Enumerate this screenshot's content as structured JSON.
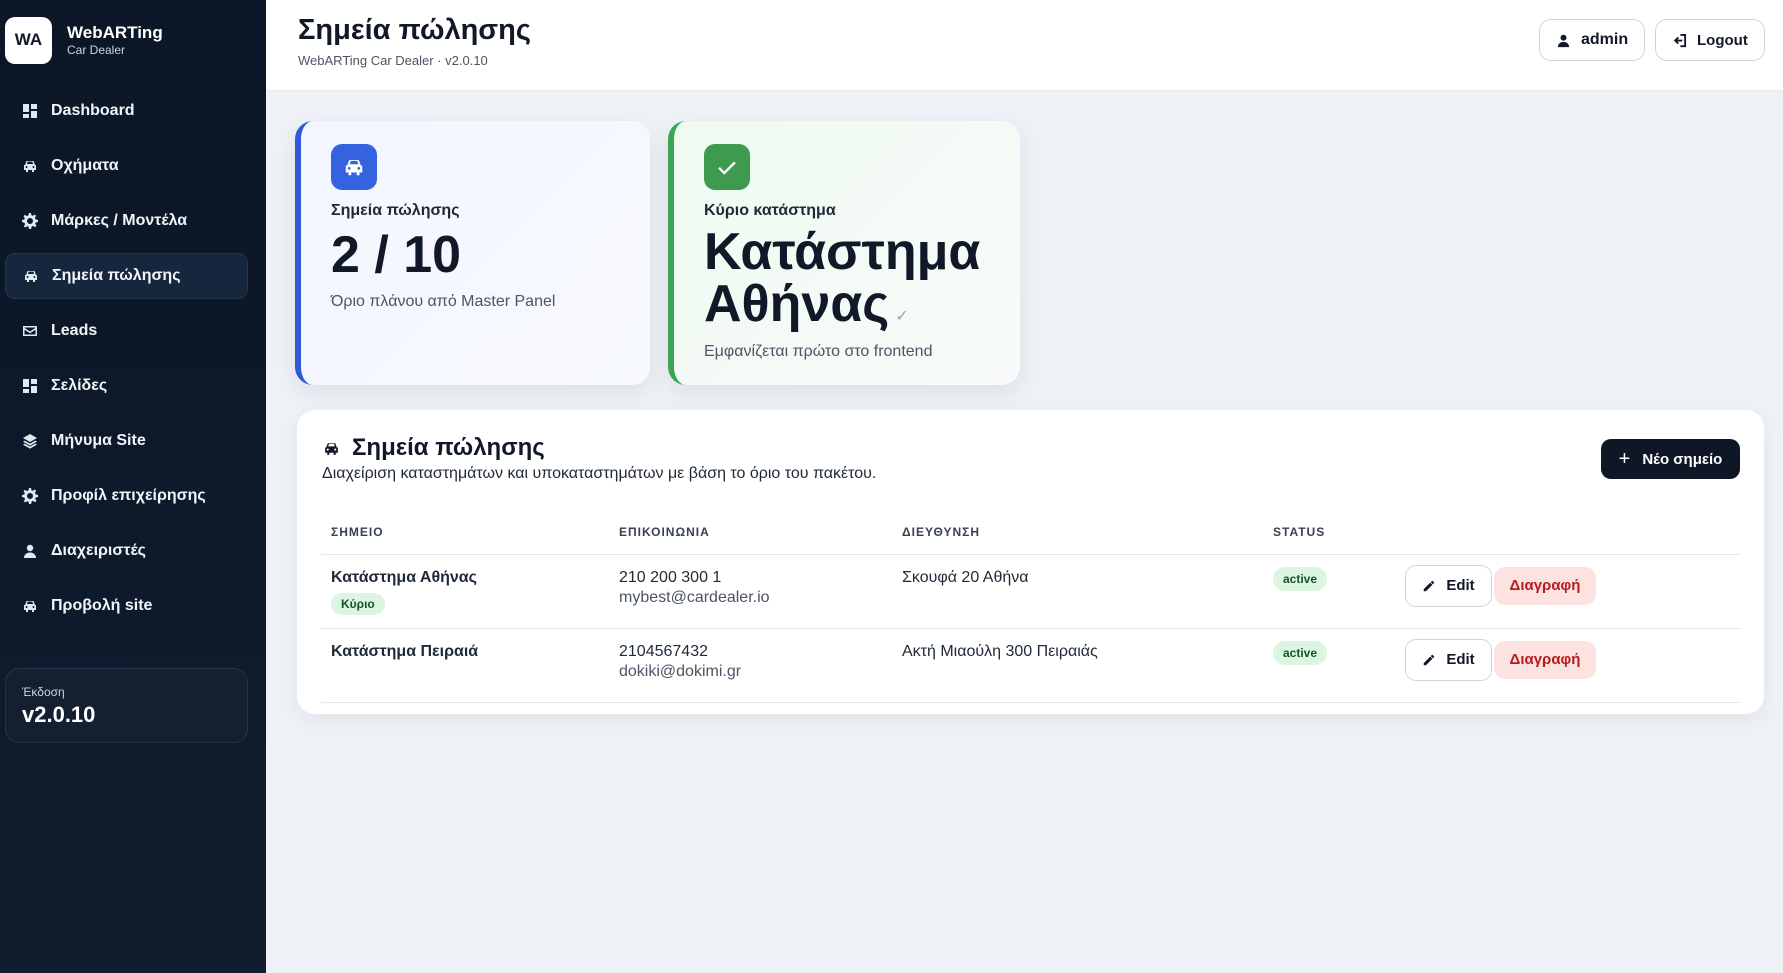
{
  "brand": {
    "logo": "WA",
    "name": "WebARTing",
    "sub": "Car Dealer"
  },
  "sidebar": {
    "items": [
      {
        "label": "Dashboard",
        "icon": "dashboard-icon"
      },
      {
        "label": "Οχήματα",
        "icon": "car-icon"
      },
      {
        "label": "Μάρκες / Μοντέλα",
        "icon": "gear-icon"
      },
      {
        "label": "Σημεία πώλησης",
        "icon": "car-icon",
        "active": true
      },
      {
        "label": "Leads",
        "icon": "mail-icon"
      },
      {
        "label": "Σελίδες",
        "icon": "dashboard-icon"
      },
      {
        "label": "Μήνυμα Site",
        "icon": "layers-icon"
      },
      {
        "label": "Προφίλ επιχείρησης",
        "icon": "gear-icon"
      },
      {
        "label": "Διαχειριστές",
        "icon": "user-icon"
      },
      {
        "label": "Προβολή site",
        "icon": "car-icon"
      }
    ],
    "version_label": "Έκδοση",
    "version_value": "v2.0.10"
  },
  "header": {
    "title": "Σημεία πώλησης",
    "subtitle": "WebARTing Car Dealer · v2.0.10",
    "user_label": "admin",
    "logout_label": "Logout"
  },
  "stats": {
    "points": {
      "label": "Σημεία πώλησης",
      "value": "2 / 10",
      "note": "Όριο πλάνου από Master Panel"
    },
    "main_store": {
      "label": "Κύριο κατάστημα",
      "value": "Κατάστημα Αθήνας",
      "note": "Εμφανίζεται πρώτο στο frontend"
    }
  },
  "panel": {
    "title": "Σημεία πώλησης",
    "description": "Διαχείριση καταστημάτων και υποκαταστημάτων με βάση το όριο του πακέτου.",
    "new_button": "Νέο σημείο",
    "columns": [
      "ΣΗΜΕΙΟ",
      "ΕΠΙΚΟΙΝΩΝΙΑ",
      "ΔΙΕΥΘΥΝΣΗ",
      "STATUS"
    ],
    "rows": [
      {
        "name": "Κατάστημα Αθήνας",
        "badge": "Κύριο",
        "phone": "210 200 300 1",
        "email": "mybest@cardealer.io",
        "address": "Σκουφά 20 Αθήνα",
        "status": "active",
        "edit": "Edit",
        "delete": "Διαγραφή"
      },
      {
        "name": "Κατάστημα Πειραιά",
        "badge": "",
        "phone": "2104567432",
        "email": "dokiki@dokimi.gr",
        "address": "Ακτή Μιαούλη 300 Πειραιάς",
        "status": "active",
        "edit": "Edit",
        "delete": "Διαγραφή"
      }
    ]
  }
}
